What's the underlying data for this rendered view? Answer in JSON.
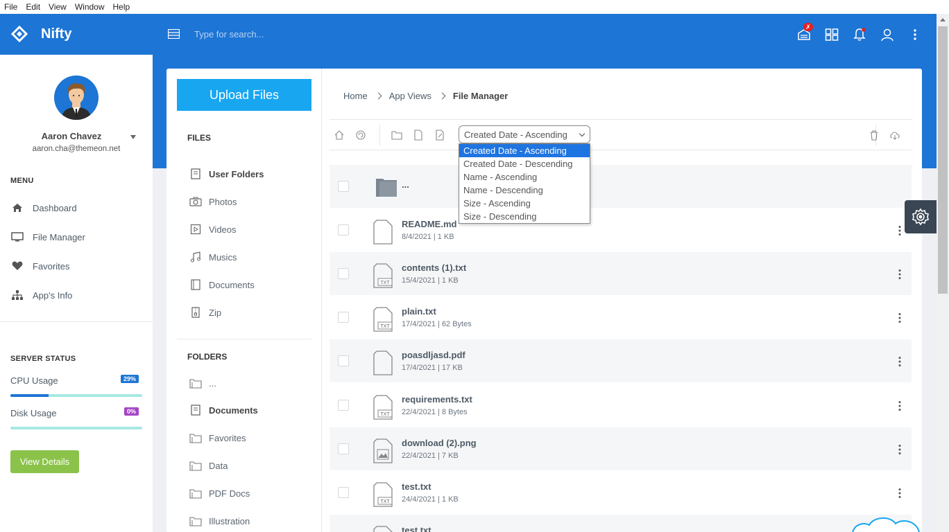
{
  "menubar": [
    "File",
    "Edit",
    "View",
    "Window",
    "Help"
  ],
  "brand": {
    "name": "Nifty"
  },
  "search": {
    "placeholder": "Type for search..."
  },
  "user": {
    "name": "Aaron Chavez",
    "email": "aaron.cha@themeon.net"
  },
  "menu": {
    "title": "MENU",
    "items": [
      {
        "label": "Dashboard",
        "icon": "home-icon"
      },
      {
        "label": "File Manager",
        "icon": "monitor-icon"
      },
      {
        "label": "Favorites",
        "icon": "heart-icon"
      },
      {
        "label": "App's Info",
        "icon": "sitemap-icon"
      }
    ]
  },
  "server": {
    "title": "SERVER STATUS",
    "cpu": {
      "label": "CPU Usage",
      "badge": "29%",
      "value": 29
    },
    "disk": {
      "label": "Disk Usage",
      "badge": "0%",
      "value": 0
    },
    "button": "View Details"
  },
  "files_pane": {
    "upload": "Upload Files",
    "files_title": "FILES",
    "files": [
      {
        "label": "User Folders",
        "icon": "user-folder-icon",
        "active": true
      },
      {
        "label": "Photos",
        "icon": "camera-icon"
      },
      {
        "label": "Videos",
        "icon": "video-icon"
      },
      {
        "label": "Musics",
        "icon": "music-icon"
      },
      {
        "label": "Documents",
        "icon": "book-icon"
      },
      {
        "label": "Zip",
        "icon": "zip-icon"
      }
    ],
    "folders_title": "FOLDERS",
    "folders": [
      {
        "label": "...",
        "active": false
      },
      {
        "label": "Documents",
        "active": true
      },
      {
        "label": "Favorites",
        "active": false
      },
      {
        "label": "Data",
        "active": false
      },
      {
        "label": "PDF Docs",
        "active": false
      },
      {
        "label": "Illustration",
        "active": false
      }
    ]
  },
  "breadcrumb": {
    "home": "Home",
    "app": "App Views",
    "current": "File Manager"
  },
  "sort": {
    "selected": "Created Date - Ascending",
    "options": [
      "Created Date - Ascending",
      "Created Date - Descending",
      "Name - Ascending",
      "Name - Descending",
      "Size - Ascending",
      "Size - Descending"
    ]
  },
  "rows": [
    {
      "name": "...",
      "meta": "",
      "type": "folder"
    },
    {
      "name": "README.md",
      "meta": "8/4/2021 | 1 KB",
      "type": "file"
    },
    {
      "name": "contents (1).txt",
      "meta": "15/4/2021 | 1 KB",
      "type": "txt"
    },
    {
      "name": "plain.txt",
      "meta": "17/4/2021 | 62 Bytes",
      "type": "txt"
    },
    {
      "name": "poasdljasd.pdf",
      "meta": "17/4/2021 | 17 KB",
      "type": "file"
    },
    {
      "name": "requirements.txt",
      "meta": "22/4/2021 | 8 Bytes",
      "type": "txt"
    },
    {
      "name": "download (2).png",
      "meta": "22/4/2021 | 7 KB",
      "type": "image"
    },
    {
      "name": "test.txt",
      "meta": "24/4/2021 | 1 KB",
      "type": "txt"
    },
    {
      "name": "test.txt",
      "meta": "",
      "type": "txt"
    }
  ],
  "notifications": {
    "mail_badge": "✗"
  },
  "colors": {
    "header": "#1d75d5",
    "upload": "#18a6f1",
    "cpu_badge": "#1d75d5",
    "disk_badge": "#a545c6",
    "view_details": "#8bc34a"
  }
}
